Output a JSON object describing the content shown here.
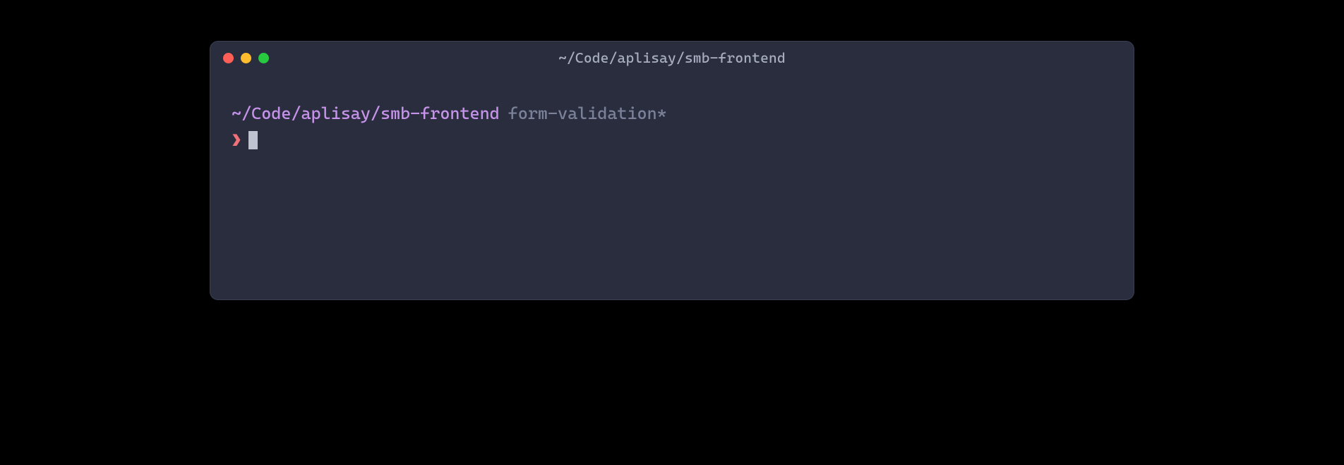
{
  "window": {
    "title": "~/Code/aplisay/smb-frontend"
  },
  "prompt": {
    "cwd": "~/Code/aplisay/smb-frontend",
    "branch": "form-validation*",
    "symbol": "❯"
  },
  "colors": {
    "bg": "#292d3e",
    "fg": "#d0d4e3",
    "purple": "#c792ea",
    "muted": "#7b8199",
    "pink": "#f07178"
  }
}
